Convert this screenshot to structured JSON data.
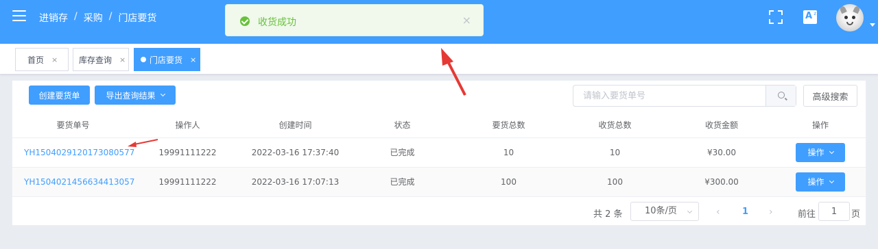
{
  "header": {
    "breadcrumb": [
      "进销存",
      "采购",
      "门店要货"
    ],
    "toast": {
      "message": "收货成功",
      "close": "×"
    },
    "colors": {
      "primary": "#409eff",
      "success": "#67c23a"
    },
    "icons": [
      "menu-icon",
      "fullscreen-icon",
      "language-icon",
      "avatar",
      "caret-down-icon"
    ],
    "language_icon": {
      "letter": "A",
      "sup": "z"
    }
  },
  "tags": [
    {
      "label": "首页",
      "close": "×",
      "active": false
    },
    {
      "label": "库存查询",
      "close": "×",
      "active": false
    },
    {
      "label": "门店要货",
      "close": "×",
      "active": true
    }
  ],
  "toolbar": {
    "create_label": "创建要货单",
    "export_label": "导出查询结果",
    "search_placeholder": "请输入要货单号",
    "advanced_label": "高级搜索"
  },
  "table": {
    "columns": [
      "要货单号",
      "操作人",
      "创建时间",
      "状态",
      "要货总数",
      "收货总数",
      "收货金额",
      "操作"
    ],
    "rows": [
      {
        "order_no": "YH1504029120173080577",
        "operator": "19991111222",
        "created": "2022-03-16 17:37:40",
        "status": "已完成",
        "request_total": "10",
        "received_total": "10",
        "amount": "¥30.00",
        "action": "操作"
      },
      {
        "order_no": "YH1504021456634413057",
        "operator": "19991111222",
        "created": "2022-03-16 17:07:13",
        "status": "已完成",
        "request_total": "100",
        "received_total": "100",
        "amount": "¥300.00",
        "action": "操作"
      }
    ]
  },
  "pagination": {
    "total": "共 2 条",
    "page_size": "10条/页",
    "prev": "‹",
    "current": "1",
    "next": "›",
    "goto": "前往",
    "jump_value": "1",
    "page_suffix": "页"
  }
}
